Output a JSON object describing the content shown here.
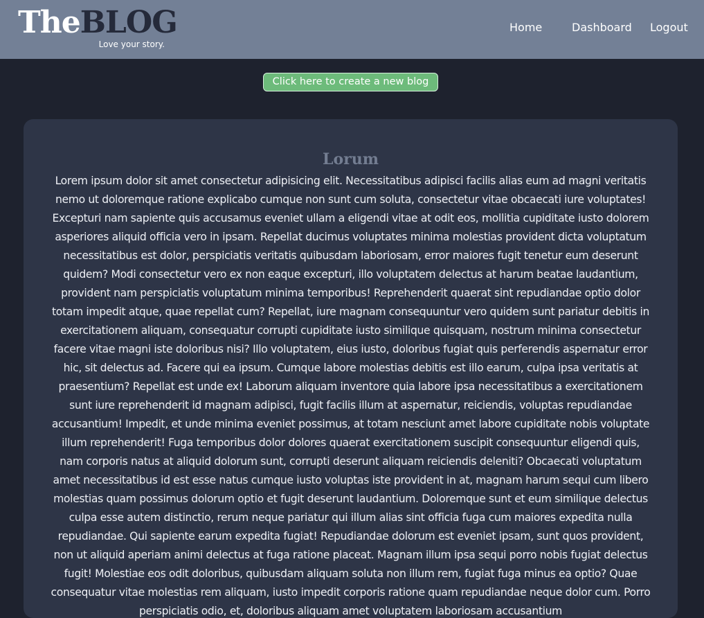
{
  "header": {
    "brand_the": "The",
    "brand_blog": "BLOG",
    "tagline": "Love your story.",
    "nav": {
      "home": "Home",
      "dashboard": "Dashboard",
      "logout": "Logout"
    }
  },
  "main": {
    "create_button_label": "Click here to create a new blog",
    "post": {
      "title": "Lorum",
      "body": "Lorem ipsum dolor sit amet consectetur adipisicing elit. Necessitatibus adipisci facilis alias eum ad magni veritatis nemo ut doloremque ratione explicabo cumque non sunt cum soluta, consectetur vitae obcaecati iure voluptates! Excepturi nam sapiente quis accusamus eveniet ullam a eligendi vitae at odit eos, mollitia cupiditate iusto dolorem asperiores aliquid officia vero in ipsam. Repellat ducimus voluptates minima molestias provident dicta voluptatum necessitatibus est dolor, perspiciatis veritatis quibusdam laboriosam, error maiores fugit tenetur eum deserunt quidem? Modi consectetur vero ex non eaque excepturi, illo voluptatem delectus at harum beatae laudantium, provident nam perspiciatis voluptatum minima temporibus! Reprehenderit quaerat sint repudiandae optio dolor totam impedit atque, quae repellat cum? Repellat, iure magnam consequuntur vero quidem sunt pariatur debitis in exercitationem aliquam, consequatur corrupti cupiditate iusto similique quisquam, nostrum minima consectetur facere vitae magni iste doloribus nisi? Illo voluptatem, eius iusto, doloribus fugiat quis perferendis aspernatur error hic, sit delectus ad. Facere qui ea ipsum. Cumque labore molestias debitis est illo earum, culpa ipsa veritatis at praesentium? Repellat est unde ex! Laborum aliquam inventore quia labore ipsa necessitatibus a exercitationem sunt iure reprehenderit id magnam adipisci, fugit facilis illum at aspernatur, reiciendis, voluptas repudiandae accusantium! Impedit, et unde minima eveniet possimus, at totam nesciunt amet labore cupiditate nobis voluptate illum reprehenderit! Fuga temporibus dolor dolores quaerat exercitationem suscipit consequuntur eligendi quis, nam corporis natus at aliquid dolorum sunt, corrupti deserunt aliquam reiciendis deleniti? Obcaecati voluptatum amet necessitatibus id est esse natus cumque iusto voluptas iste provident in at, magnam harum sequi cum libero molestias quam possimus dolorum optio et fugit deserunt laudantium. Doloremque sunt et eum similique delectus culpa esse autem distinctio, rerum neque pariatur qui illum alias sint officia fuga cum maiores expedita nulla repudiandae. Qui sapiente earum expedita fugiat! Repudiandae dolorum est eveniet ipsam, sunt quos provident, non ut aliquid aperiam animi delectus at fuga ratione placeat. Magnam illum ipsa sequi porro nobis fugiat delectus fugit! Molestiae eos odit doloribus, quibusdam aliquam soluta non illum rem, fugiat fuga minus ea optio? Quae consequatur vitae molestias rem aliquam, iusto impedit corporis ratione quam repudiandae neque dolor cum. Porro perspiciatis odio, et, doloribus aliquam amet voluptatem laboriosam accusantium"
    }
  },
  "colors": {
    "header_bg": "#738096",
    "page_bg": "#1e222e",
    "card_bg": "#2e3547",
    "button_bg": "#6dbb7b",
    "title_color": "#737d91",
    "brand_dark": "#252a3a"
  }
}
